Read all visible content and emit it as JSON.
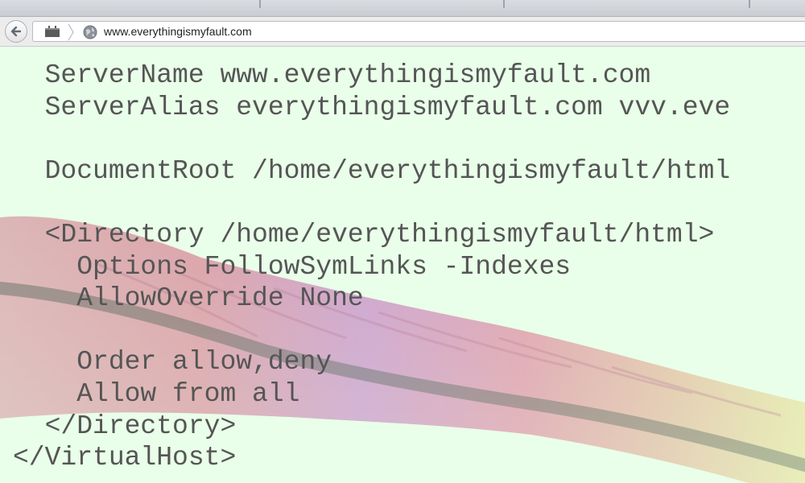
{
  "browser": {
    "url": "www.everythingismyfault.com",
    "icons": {
      "back": "back-arrow-icon",
      "identity": "page-identity-icon",
      "site": "globe-icon",
      "separator": "chevron-right-icon"
    }
  },
  "content": {
    "background_color": "#e9ffe9",
    "text_color": "#555555",
    "watermark": "apache-feather-logo",
    "code_lines": [
      "  ServerName www.everythingismyfault.com",
      "  ServerAlias everythingismyfault.com vvv.eve",
      "",
      "  DocumentRoot /home/everythingismyfault/html",
      "",
      "  <Directory /home/everythingismyfault/html>",
      "    Options FollowSymLinks -Indexes",
      "    AllowOverride None",
      "",
      "    Order allow,deny",
      "    Allow from all",
      "  </Directory>",
      "</VirtualHost>"
    ]
  }
}
